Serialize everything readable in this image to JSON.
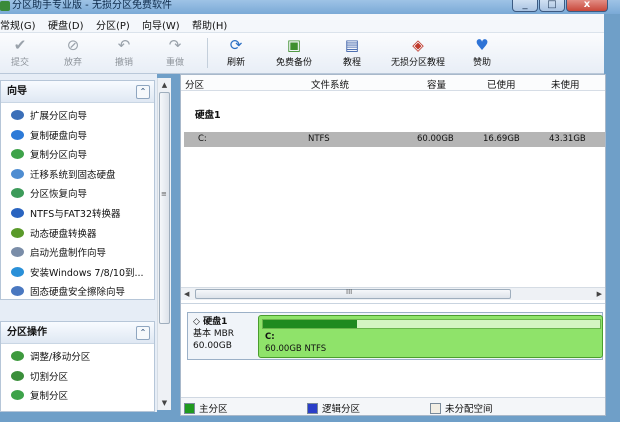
{
  "window": {
    "title": "分区助手专业版 - 无损分区免费软件",
    "buttons": [
      "_",
      "□",
      "x"
    ]
  },
  "menu": [
    "常规(G)",
    "硬盘(D)",
    "分区(P)",
    "向导(W)",
    "帮助(H)"
  ],
  "toolbar": {
    "submit": "提交",
    "discard": "放弃",
    "undo": "撤销",
    "redo": "重做",
    "refresh": "刷新",
    "free_backup": "免费备份",
    "tutorial": "教程",
    "lossless_tutorial": "无损分区教程",
    "donate": "赞助"
  },
  "sidebar": {
    "wizard": {
      "title": "向导",
      "items": [
        "扩展分区向导",
        "复制硬盘向导",
        "复制分区向导",
        "迁移系统到固态硬盘",
        "分区恢复向导",
        "NTFS与FAT32转换器",
        "动态硬盘转换器",
        "启动光盘制作向导",
        "安装Windows 7/8/10到...",
        "固态硬盘安全擦除向导"
      ]
    },
    "partition_ops": {
      "title": "分区操作",
      "items": [
        "调整/移动分区",
        "切割分区",
        "复制分区"
      ]
    }
  },
  "table": {
    "columns": [
      "分区",
      "文件系统",
      "容量",
      "已使用",
      "未使用"
    ],
    "disk_label": "硬盘1",
    "rows": [
      {
        "partition": "C:",
        "fs": "NTFS",
        "capacity": "60.00GB",
        "used": "16.69GB",
        "unused": "43.31GB"
      }
    ]
  },
  "scroll": {
    "h_grip": "III"
  },
  "diskmap": {
    "name": "硬盘1",
    "type": "基本 MBR",
    "size": "60.00GB",
    "partition_label": "C:",
    "partition_detail": "60.00GB NTFS",
    "used_fraction": 0.278
  },
  "legend": {
    "primary": "主分区",
    "logical": "逻辑分区",
    "unallocated": "未分配空间"
  },
  "colors": {
    "primary": "#1f9a1f",
    "logical": "#2a3ec8",
    "unallocated": "#f2eee4",
    "partition_bar": "#8fe36a"
  }
}
